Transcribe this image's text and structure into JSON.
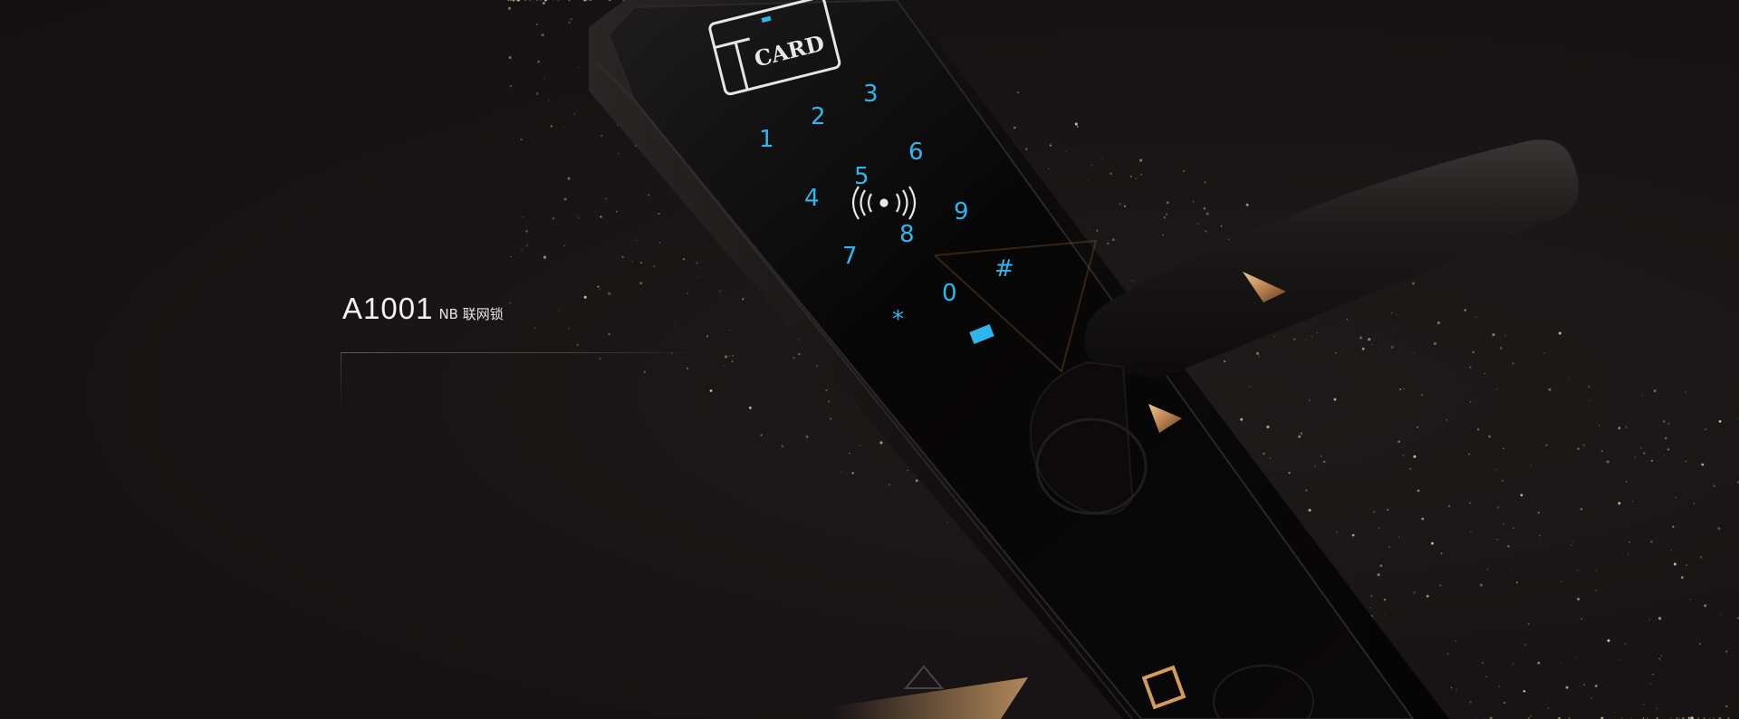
{
  "product": {
    "model": "A1001",
    "subtitle": "NB 联网锁"
  },
  "lock": {
    "card_label": "CARD",
    "keys": [
      "1",
      "2",
      "3",
      "4",
      "5",
      "6",
      "7",
      "8",
      "9",
      "*",
      "0",
      "#"
    ]
  },
  "colors": {
    "background": "#1a1617",
    "key_glow": "#2fb6ee",
    "accent_gold": "#c8955a",
    "text": "#f2f2f2"
  },
  "icons": [
    "nfc-icon",
    "card-reader-icon",
    "status-led-icon",
    "triangle-icon",
    "square-icon"
  ]
}
